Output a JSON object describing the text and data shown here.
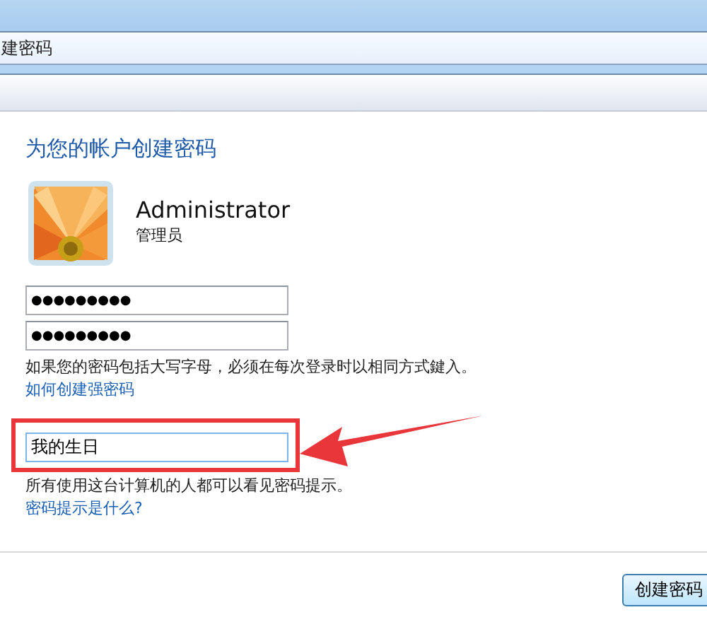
{
  "breadcrumb": "建密码",
  "heading": "为您的帐户创建密码",
  "account": {
    "name": "Administrator",
    "role": "管理员"
  },
  "password_fields": [
    {
      "value": "●●●●●●●●●"
    },
    {
      "value": "●●●●●●●●●"
    }
  ],
  "caps_note": "如果您的密码包括大写字母，必须在每次登录时以相同方式鍵入。",
  "strong_link": "如何创建强密码",
  "hint_field": {
    "value": "我的生日"
  },
  "hint_note": "所有使用这台计算机的人都可以看见密码提示。",
  "hint_link": "密码提示是什么?",
  "buttons": [
    "创建密码"
  ]
}
